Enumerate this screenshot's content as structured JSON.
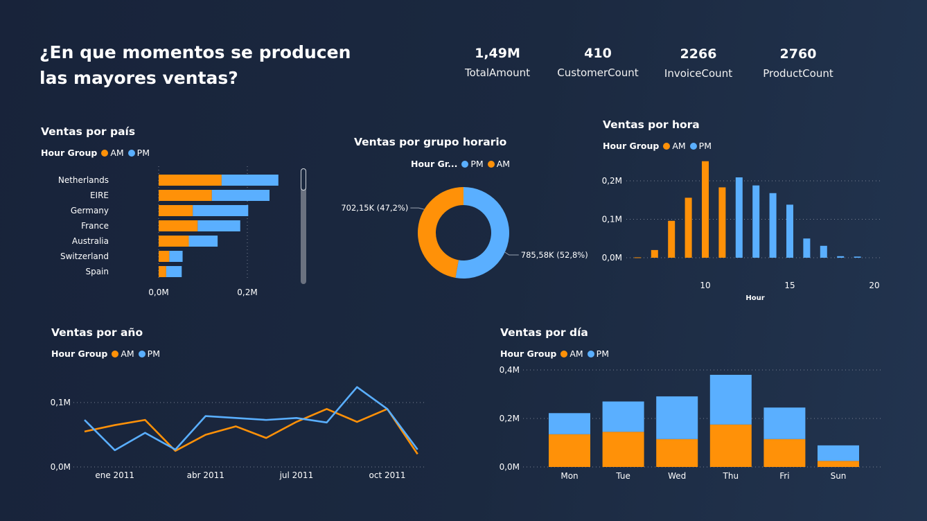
{
  "title": "¿En que momentos se producen las mayores ventas?",
  "kpis": [
    {
      "value": "1,49M",
      "label": "TotalAmount"
    },
    {
      "value": "410",
      "label": "CustomerCount"
    },
    {
      "value": "2266",
      "label": "InvoiceCount"
    },
    {
      "value": "2760",
      "label": "ProductCount"
    }
  ],
  "colors": {
    "am": "#ff9108",
    "pm": "#5aafff",
    "grid": "#7b8394"
  },
  "legend_ams_pm": {
    "title": "Hour Group",
    "am": "AM",
    "pm": "PM"
  },
  "legend_donut": {
    "title": "Hour Gr...",
    "pm": "PM",
    "am": "AM"
  },
  "chart_data": [
    {
      "id": "pais",
      "type": "bar",
      "orientation": "horizontal",
      "stacked": true,
      "title": "Ventas por país",
      "categories": [
        "Netherlands",
        "EIRE",
        "Germany",
        "France",
        "Australia",
        "Switzerland",
        "Spain"
      ],
      "series": [
        {
          "name": "AM",
          "values": [
            0.142,
            0.12,
            0.077,
            0.088,
            0.068,
            0.024,
            0.017
          ]
        },
        {
          "name": "PM",
          "values": [
            0.128,
            0.13,
            0.125,
            0.096,
            0.065,
            0.03,
            0.035
          ]
        }
      ],
      "xticks": [
        "0,0M",
        "0,2M"
      ],
      "xtick_values": [
        0,
        0.2
      ],
      "xlim": [
        0,
        0.3
      ]
    },
    {
      "id": "grupo",
      "type": "pie",
      "donut": true,
      "title": "Ventas por grupo horario",
      "labels": [
        "PM",
        "AM"
      ],
      "values": [
        785.58,
        702.15
      ],
      "data_labels": [
        "785,58K (52,8%)",
        "702,15K (47,2%)"
      ]
    },
    {
      "id": "hora",
      "type": "bar",
      "title": "Ventas por hora",
      "xlabel": "Hour",
      "x": [
        6,
        7,
        8,
        9,
        10,
        11,
        12,
        13,
        14,
        15,
        16,
        17,
        18,
        19
      ],
      "values": [
        0.001,
        0.02,
        0.096,
        0.156,
        0.251,
        0.183,
        0.209,
        0.188,
        0.168,
        0.138,
        0.05,
        0.031,
        0.004,
        0.003
      ],
      "groups": [
        "AM",
        "AM",
        "AM",
        "AM",
        "AM",
        "AM",
        "PM",
        "PM",
        "PM",
        "PM",
        "PM",
        "PM",
        "PM",
        "PM"
      ],
      "xticks": [
        "10",
        "15",
        "20"
      ],
      "xtick_values": [
        10,
        15,
        20
      ],
      "yticks": [
        "0,0M",
        "0,1M",
        "0,2M"
      ],
      "ytick_values": [
        0,
        0.1,
        0.2
      ],
      "xlim": [
        5.5,
        20
      ],
      "ylim": [
        0,
        0.25
      ]
    },
    {
      "id": "anio",
      "type": "line",
      "title": "Ventas por año",
      "x": [
        "2010-12",
        "2011-01",
        "2011-02",
        "2011-03",
        "2011-04",
        "2011-05",
        "2011-06",
        "2011-07",
        "2011-08",
        "2011-09",
        "2011-10",
        "2011-11",
        "2011-12"
      ],
      "series": [
        {
          "name": "AM",
          "values": [
            0.055,
            0.065,
            0.073,
            0.025,
            0.05,
            0.063,
            0.045,
            0.07,
            0.09,
            0.07,
            0.09,
            0.02,
            null
          ]
        },
        {
          "name": "PM",
          "values": [
            0.073,
            0.026,
            0.053,
            0.027,
            0.079,
            0.076,
            0.073,
            0.076,
            0.069,
            0.124,
            0.09,
            0.027,
            null
          ]
        }
      ],
      "xticks": [
        "ene 2011",
        "abr 2011",
        "jul 2011",
        "oct 2011"
      ],
      "xtick_values": [
        "2011-01",
        "2011-04",
        "2011-07",
        "2011-10"
      ],
      "yticks": [
        "0,0M",
        "0,1M"
      ],
      "ytick_values": [
        0,
        0.1
      ],
      "ylim": [
        0,
        0.13
      ]
    },
    {
      "id": "dia",
      "type": "bar",
      "stacked": true,
      "title": "Ventas por día",
      "categories": [
        "Mon",
        "Tue",
        "Wed",
        "Thu",
        "Fri",
        "Sun"
      ],
      "series": [
        {
          "name": "AM",
          "values": [
            0.135,
            0.145,
            0.115,
            0.175,
            0.115,
            0.025
          ]
        },
        {
          "name": "PM",
          "values": [
            0.087,
            0.125,
            0.176,
            0.205,
            0.13,
            0.064
          ]
        }
      ],
      "yticks": [
        "0,0M",
        "0,2M",
        "0,4M"
      ],
      "ytick_values": [
        0,
        0.2,
        0.4
      ],
      "ylim": [
        0,
        0.4
      ]
    }
  ]
}
